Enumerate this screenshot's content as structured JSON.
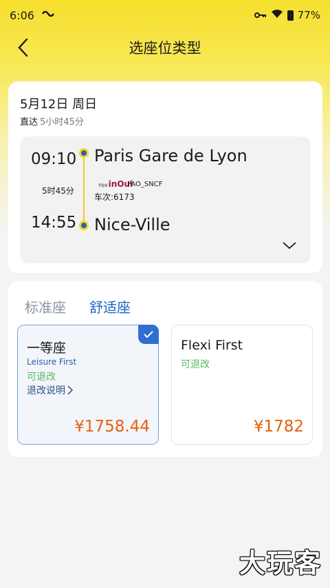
{
  "status_bar": {
    "time": "6:06",
    "battery": "77%"
  },
  "header": {
    "title": "选座位类型"
  },
  "trip": {
    "date": "5月12日 周日",
    "type": "直达",
    "duration": "5小时45分",
    "dep_time": "09:10",
    "arr_time": "14:55",
    "short_duration": "5时45分",
    "dep_station": "Paris Gare de Lyon",
    "arr_station": "Nice-Ville",
    "brand_small": "TGV",
    "brand": "inOui",
    "operator": "PAO_SNCF",
    "train_no": "车次:6173"
  },
  "seat": {
    "tabs": [
      "标准座",
      "舒适座"
    ],
    "selected_tab": "舒适座",
    "options": [
      {
        "name": "一等座",
        "subtitle": "Leisure First",
        "refund": "可退改",
        "rules": "退改说明",
        "price": "¥1758.44",
        "selected": true
      },
      {
        "name": "Flexi First",
        "refund": "可退改",
        "price": "¥1782",
        "selected": false
      }
    ]
  },
  "watermark": "大玩客",
  "colors": {
    "accent_yellow": "#f6df2c",
    "accent_blue": "#2f6fd1",
    "price_orange": "#e8600a",
    "refund_green": "#5cb85c"
  }
}
